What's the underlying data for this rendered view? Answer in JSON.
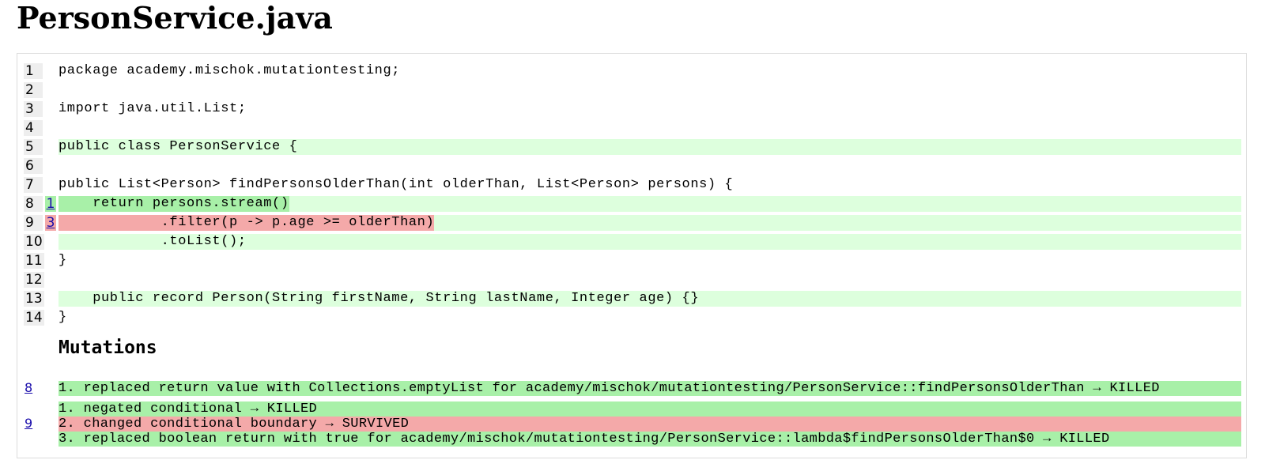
{
  "page": {
    "title": "PersonService.java"
  },
  "colors": {
    "covered": "#ddffdd",
    "killed": "#a8f0a8",
    "survived": "#f4a9a9",
    "link": "#1a0dab",
    "lineno_bg": "#eeeeee"
  },
  "code_lines": [
    {
      "no": "1",
      "mutations": "",
      "status": "",
      "covered": false,
      "highlight": "",
      "code": "package academy.mischok.mutationtesting;"
    },
    {
      "no": "2",
      "mutations": "",
      "status": "",
      "covered": false,
      "highlight": "",
      "code": ""
    },
    {
      "no": "3",
      "mutations": "",
      "status": "",
      "covered": false,
      "highlight": "",
      "code": "import java.util.List;"
    },
    {
      "no": "4",
      "mutations": "",
      "status": "",
      "covered": false,
      "highlight": "",
      "code": ""
    },
    {
      "no": "5",
      "mutations": "",
      "status": "",
      "covered": true,
      "highlight": "",
      "code": "public class PersonService {"
    },
    {
      "no": "6",
      "mutations": "",
      "status": "",
      "covered": false,
      "highlight": "",
      "code": ""
    },
    {
      "no": "7",
      "mutations": "",
      "status": "",
      "covered": false,
      "highlight": "",
      "code": "public List<Person> findPersonsOlderThan(int olderThan, List<Person> persons) {"
    },
    {
      "no": "8",
      "mutations": "1",
      "status": "killed",
      "covered": true,
      "highlight": "killed",
      "code": "    return persons.stream()"
    },
    {
      "no": "9",
      "mutations": "3",
      "status": "survived",
      "covered": true,
      "highlight": "survived",
      "code": "            .filter(p -> p.age >= olderThan)"
    },
    {
      "no": "10",
      "mutations": "",
      "status": "",
      "covered": true,
      "highlight": "",
      "code": "            .toList();"
    },
    {
      "no": "11",
      "mutations": "",
      "status": "",
      "covered": false,
      "highlight": "",
      "code": "}"
    },
    {
      "no": "12",
      "mutations": "",
      "status": "",
      "covered": false,
      "highlight": "",
      "code": ""
    },
    {
      "no": "13",
      "mutations": "",
      "status": "",
      "covered": true,
      "highlight": "",
      "code": "    public record Person(String firstName, String lastName, Integer age) {}"
    },
    {
      "no": "14",
      "mutations": "",
      "status": "",
      "covered": false,
      "highlight": "",
      "code": "}"
    }
  ],
  "mutations": {
    "heading": "Mutations",
    "groups": [
      {
        "line": "8",
        "items": [
          {
            "status": "killed",
            "text": "1. replaced return value with Collections.emptyList for academy/mischok/mutationtesting/PersonService::findPersonsOlderThan → KILLED"
          }
        ]
      },
      {
        "line": "9",
        "items": [
          {
            "status": "killed",
            "text": "1. negated conditional → KILLED"
          },
          {
            "status": "survived",
            "text": "2. changed conditional boundary → SURVIVED"
          },
          {
            "status": "killed",
            "text": "3. replaced boolean return with true for academy/mischok/mutationtesting/PersonService::lambda$findPersonsOlderThan$0 → KILLED"
          }
        ]
      }
    ]
  }
}
